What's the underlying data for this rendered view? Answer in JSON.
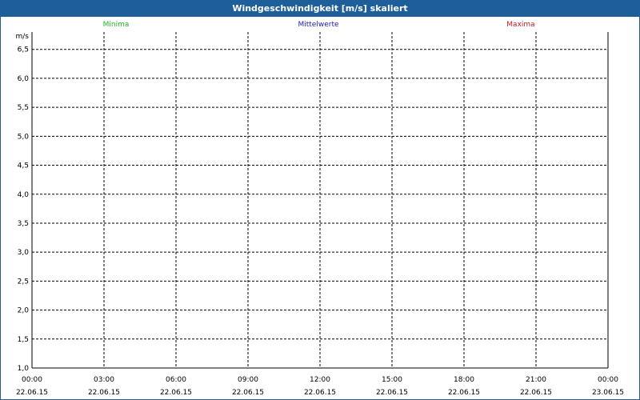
{
  "window": {
    "title": "Windgeschwindigkeit [m/s] skaliert"
  },
  "chart_data": {
    "type": "line",
    "ylabel": "m/s",
    "ylim": [
      1.0,
      6.8
    ],
    "yticks": [
      "1,0",
      "1,5",
      "2,0",
      "2,5",
      "3,0",
      "3,5",
      "4,0",
      "4,5",
      "5,0",
      "5,5",
      "6,0",
      "6,5"
    ],
    "ytick_values": [
      1.0,
      1.5,
      2.0,
      2.5,
      3.0,
      3.5,
      4.0,
      4.5,
      5.0,
      5.5,
      6.0,
      6.5
    ],
    "xticks": [
      {
        "time": "00:00",
        "date": "22.06.15"
      },
      {
        "time": "03:00",
        "date": "22.06.15"
      },
      {
        "time": "06:00",
        "date": "22.06.15"
      },
      {
        "time": "09:00",
        "date": "22.06.15"
      },
      {
        "time": "12:00",
        "date": "22.06.15"
      },
      {
        "time": "15:00",
        "date": "22.06.15"
      },
      {
        "time": "18:00",
        "date": "22.06.15"
      },
      {
        "time": "21:00",
        "date": "22.06.15"
      },
      {
        "time": "00:00",
        "date": "23.06.15"
      }
    ],
    "grid": true,
    "legend_position": "top",
    "series": [
      {
        "name": "Minima",
        "color": "#22b822",
        "values": []
      },
      {
        "name": "Mittelwerte",
        "color": "#2020c0",
        "values": []
      },
      {
        "name": "Maxima",
        "color": "#c02020",
        "values": []
      }
    ]
  }
}
